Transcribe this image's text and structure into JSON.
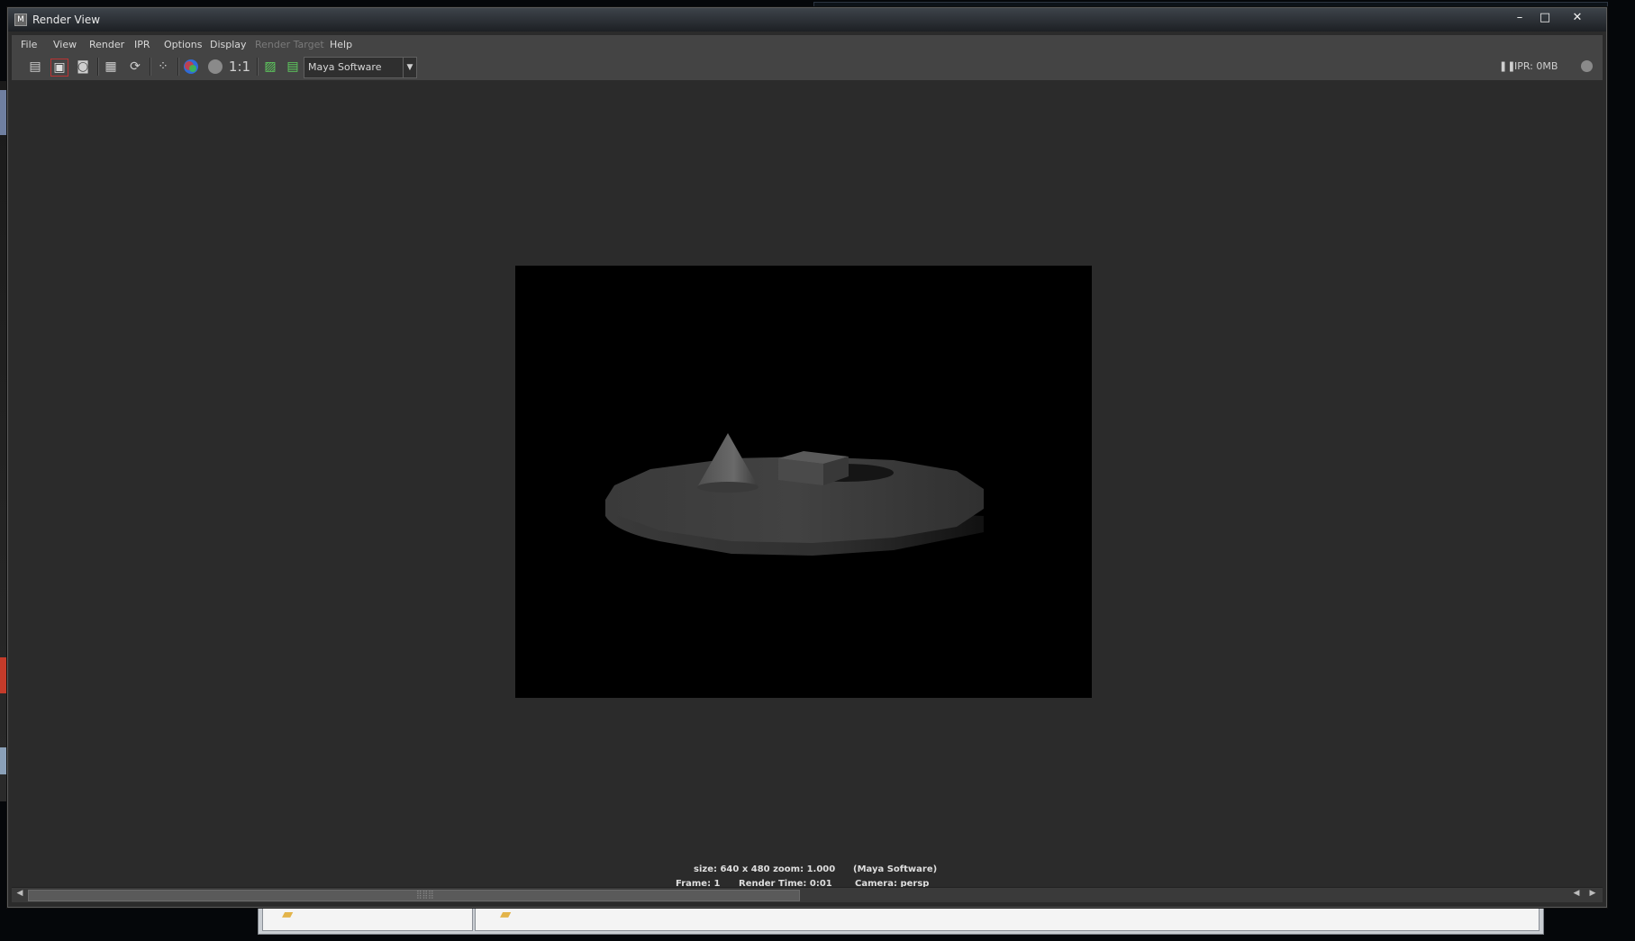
{
  "window": {
    "title": "Render View",
    "app_icon": "maya-icon",
    "controls": {
      "minimize": "–",
      "maximize": "□",
      "close": "✕"
    }
  },
  "menubar": {
    "items": [
      {
        "label": "File",
        "enabled": true
      },
      {
        "label": "View",
        "enabled": true
      },
      {
        "label": "Render",
        "enabled": true
      },
      {
        "label": "IPR",
        "enabled": true
      },
      {
        "label": "Options",
        "enabled": true
      },
      {
        "label": "Display",
        "enabled": true
      },
      {
        "label": "Render Target",
        "enabled": false
      },
      {
        "label": "Help",
        "enabled": true
      }
    ]
  },
  "toolbar": {
    "buttons": [
      {
        "name": "redo-previous-render-icon",
        "glyph": "🎬"
      },
      {
        "name": "ipr-render-icon",
        "glyph": "▣"
      },
      {
        "name": "snapshot-icon",
        "glyph": "📷"
      },
      {
        "name": "render-region-icon",
        "glyph": "▦"
      },
      {
        "name": "refresh-ipr-icon",
        "glyph": "⟳"
      },
      {
        "name": "select-tuning-region-icon",
        "glyph": "⁘"
      },
      {
        "name": "rgb-channels-icon",
        "glyph": "●"
      },
      {
        "name": "alpha-channel-icon",
        "glyph": "●"
      },
      {
        "name": "real-size-label",
        "glyph": "1:1"
      },
      {
        "name": "keep-image-icon",
        "glyph": "▨"
      },
      {
        "name": "remove-image-icon",
        "glyph": "▤"
      }
    ],
    "renderer": "Maya Software",
    "ipr_status": "IPR: 0MB",
    "pause_glyph": "❚❚"
  },
  "render_info": {
    "size": "size: 640 x 480 zoom: 1.000",
    "renderer": "(Maya Software)",
    "frame": "Frame: 1",
    "render_time": "Render Time: 0:01",
    "camera": "Camera: persp"
  },
  "scrollbar": {
    "left_arrow": "◀",
    "right_arrow_a": "◀",
    "right_arrow_b": "▶",
    "grip": "⣿⣿⣿"
  },
  "colors": {
    "panel_bg": "#2b2b2b",
    "toolbar_bg": "#444444",
    "render_bg": "#000000",
    "disc_top": "#3f3f3f",
    "disc_side": "#2c2c2c",
    "cone": "#5e5e5e",
    "cube": "#4a4a4a"
  }
}
